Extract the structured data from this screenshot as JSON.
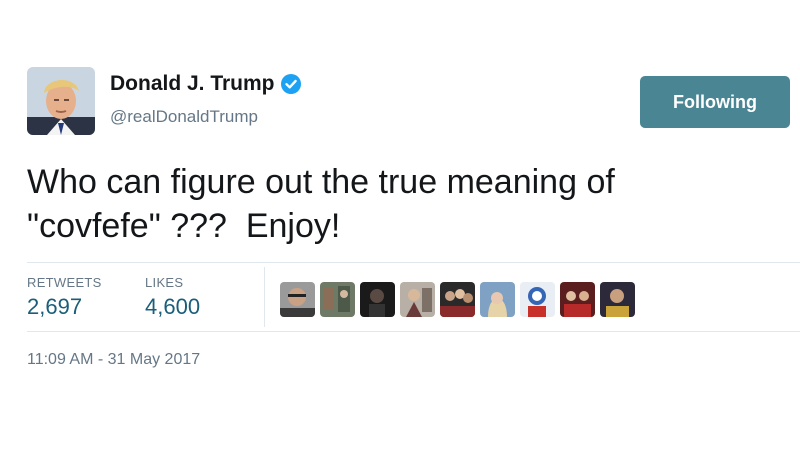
{
  "author": {
    "display_name": "Donald J. Trump",
    "handle": "@realDonaldTrump",
    "verified": true
  },
  "follow_button": {
    "label": "Following"
  },
  "tweet": {
    "text": "Who can figure out the true meaning of\n\"covfefe\" ???  Enjoy!",
    "timestamp": "11:09 AM - 31 May 2017"
  },
  "stats": {
    "retweets_label": "RETWEETS",
    "retweets_value": "2,697",
    "likes_label": "LIKES",
    "likes_value": "4,600"
  },
  "likers_count_shown": 9,
  "colors": {
    "follow_button_bg": "#4a8593",
    "stat_value": "#1b5e7a",
    "verified_badge": "#1da1f2",
    "muted_text": "#657786"
  }
}
